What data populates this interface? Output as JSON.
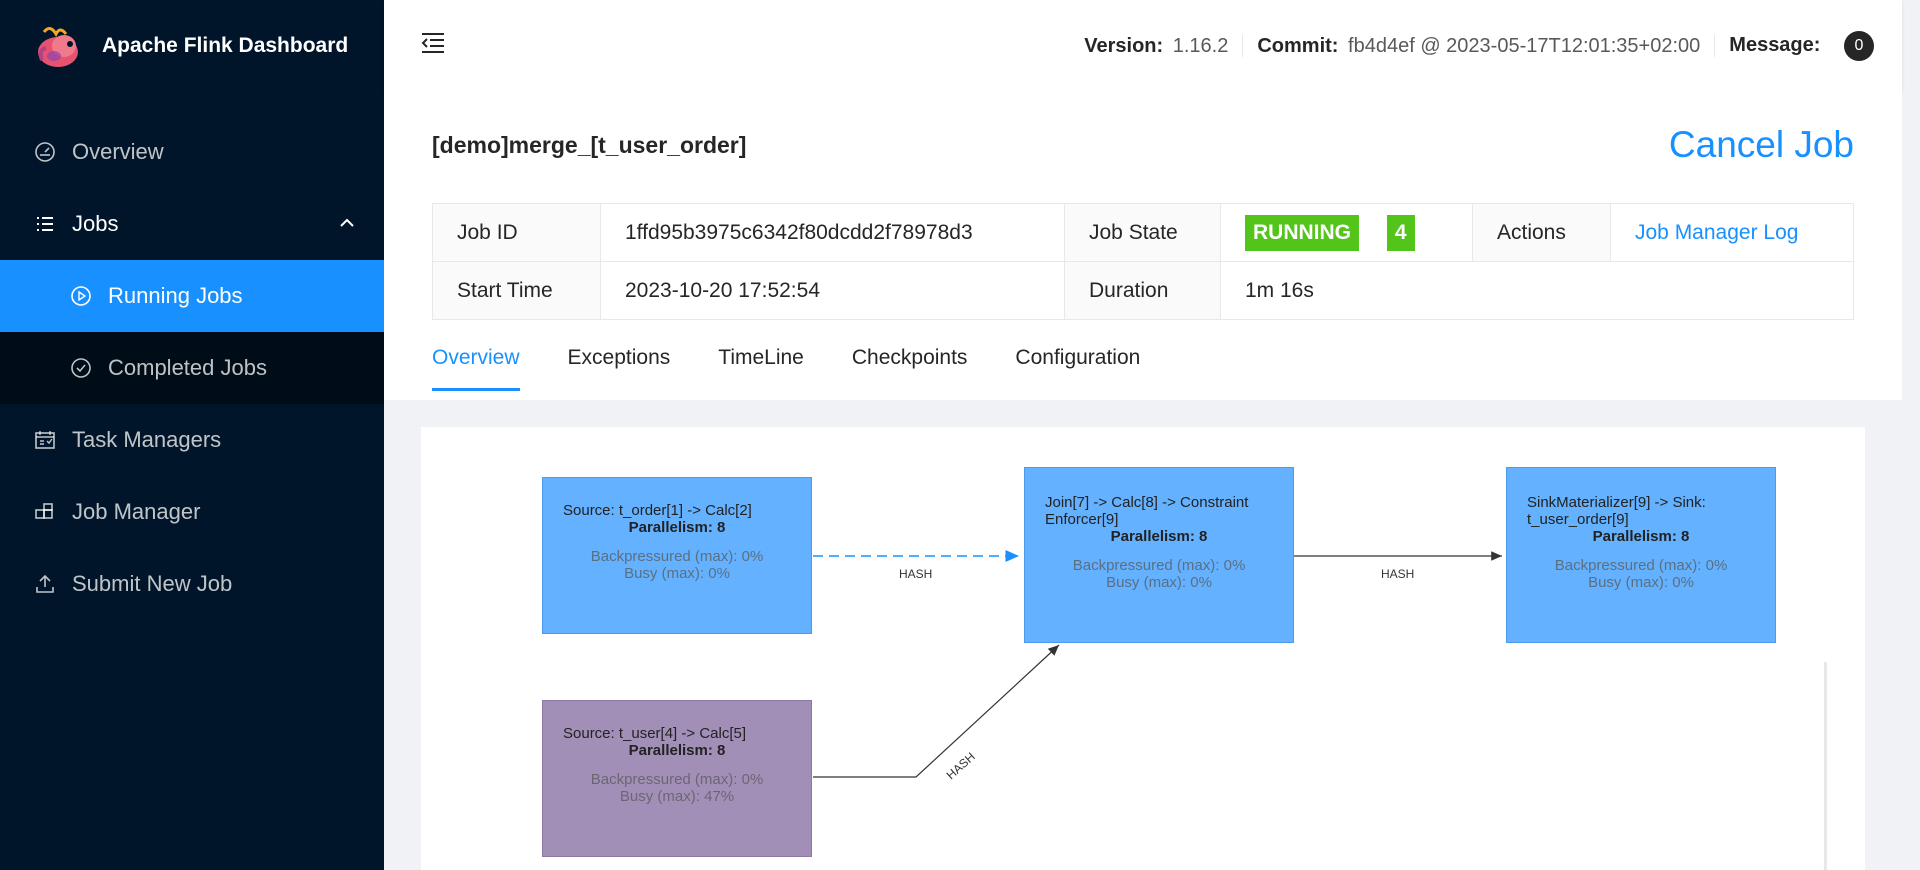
{
  "app": {
    "title": "Apache Flink Dashboard"
  },
  "sidebar": {
    "items": [
      {
        "label": "Overview",
        "icon": "dashboard-icon"
      },
      {
        "label": "Jobs",
        "icon": "list-icon"
      },
      {
        "label": "Running Jobs",
        "icon": "play-circle-icon"
      },
      {
        "label": "Completed Jobs",
        "icon": "check-circle-icon"
      },
      {
        "label": "Task Managers",
        "icon": "schedule-icon"
      },
      {
        "label": "Job Manager",
        "icon": "build-icon"
      },
      {
        "label": "Submit New Job",
        "icon": "upload-icon"
      }
    ]
  },
  "header": {
    "version_label": "Version:",
    "version": "1.16.2",
    "commit_label": "Commit:",
    "commit": "fb4d4ef @ 2023-05-17T12:01:35+02:00",
    "message_label": "Message:",
    "message_count": "0"
  },
  "job": {
    "title": "[demo]merge_[t_user_order]",
    "cancel_label": "Cancel Job",
    "id_label": "Job ID",
    "id": "1ffd95b3975c6342f80dcdd2f78978d3",
    "state_label": "Job State",
    "state": "RUNNING",
    "state_count": "4",
    "actions_label": "Actions",
    "actions_link": "Job Manager Log",
    "start_label": "Start Time",
    "start": "2023-10-20 17:52:54",
    "duration_label": "Duration",
    "duration": "1m 16s"
  },
  "tabs": [
    "Overview",
    "Exceptions",
    "TimeLine",
    "Checkpoints",
    "Configuration"
  ],
  "graph": {
    "nodes": [
      {
        "name": "Source: t_order[1] -> Calc[2]",
        "parallelism": "Parallelism: 8",
        "backpressure": "Backpressured (max): 0%",
        "busy": "Busy (max): 0%",
        "color": "#63b1ff"
      },
      {
        "name": "Join[7] -> Calc[8] -> Constraint Enforcer[9]",
        "parallelism": "Parallelism: 8",
        "backpressure": "Backpressured (max): 0%",
        "busy": "Busy (max): 0%",
        "color": "#63b1ff"
      },
      {
        "name": "SinkMaterializer[9] -> Sink: t_user_order[9]",
        "parallelism": "Parallelism: 8",
        "backpressure": "Backpressured (max): 0%",
        "busy": "Busy (max): 0%",
        "color": "#63b1ff"
      },
      {
        "name": "Source: t_user[4] -> Calc[5]",
        "parallelism": "Parallelism: 8",
        "backpressure": "Backpressured (max): 0%",
        "busy": "Busy (max): 47%",
        "color": "#a28fb8"
      }
    ],
    "edges": [
      {
        "label": "HASH"
      },
      {
        "label": "HASH"
      },
      {
        "label": "HASH"
      }
    ]
  }
}
